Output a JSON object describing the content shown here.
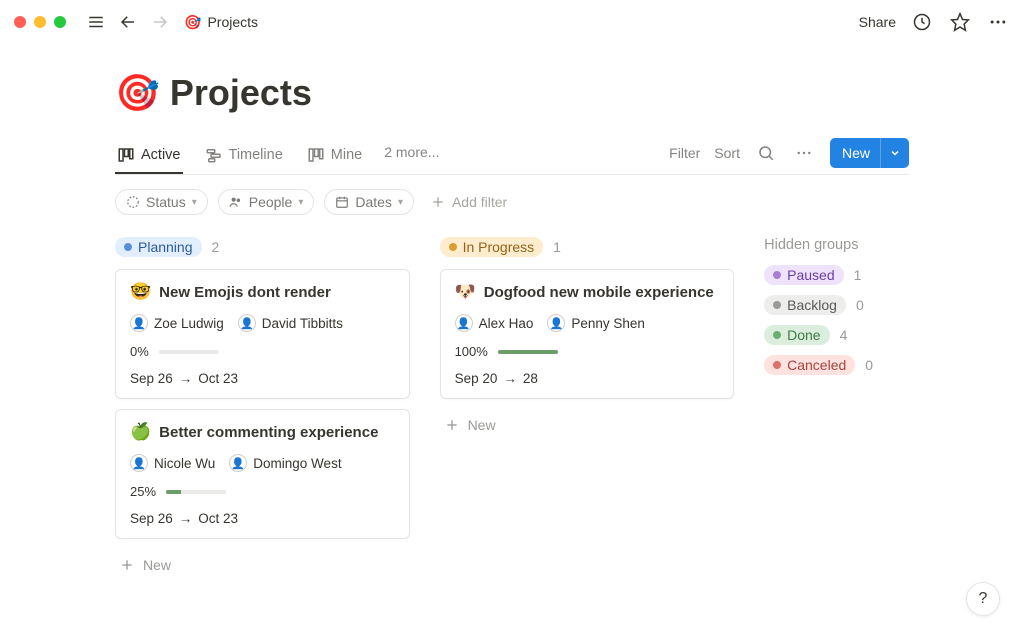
{
  "topbar": {
    "breadcrumb_icon": "🎯",
    "breadcrumb_title": "Projects",
    "share_label": "Share"
  },
  "page": {
    "icon": "🎯",
    "title": "Projects"
  },
  "tabs": {
    "items": [
      {
        "label": "Active"
      },
      {
        "label": "Timeline"
      },
      {
        "label": "Mine"
      }
    ],
    "more_label": "2 more...",
    "filter_label": "Filter",
    "sort_label": "Sort",
    "new_label": "New"
  },
  "filters": {
    "status_label": "Status",
    "people_label": "People",
    "dates_label": "Dates",
    "add_filter_label": "Add filter"
  },
  "board": {
    "columns": [
      {
        "tag_class": "planning",
        "label": "Planning",
        "count": "2",
        "cards": [
          {
            "emoji": "🤓",
            "title": "New Emojis dont  render",
            "people": [
              {
                "name": "Zoe Ludwig"
              },
              {
                "name": "David Tibbitts"
              }
            ],
            "progress_label": "0%",
            "progress_pct": 0,
            "date_from": "Sep 26",
            "date_to": "Oct 23"
          },
          {
            "emoji": "🍏",
            "title": "Better commenting experience",
            "people": [
              {
                "name": "Nicole Wu"
              },
              {
                "name": "Domingo West"
              }
            ],
            "progress_label": "25%",
            "progress_pct": 25,
            "date_from": "Sep 26",
            "date_to": "Oct 23"
          }
        ],
        "new_label": "New"
      },
      {
        "tag_class": "inprogress",
        "label": "In Progress",
        "count": "1",
        "cards": [
          {
            "emoji": "🐶",
            "title": "Dogfood new mobile experience",
            "people": [
              {
                "name": "Alex Hao"
              },
              {
                "name": "Penny Shen"
              }
            ],
            "progress_label": "100%",
            "progress_pct": 100,
            "date_from": "Sep 20",
            "date_to": "28"
          }
        ],
        "new_label": "New"
      }
    ],
    "hidden_title": "Hidden groups",
    "hidden_groups": [
      {
        "tag_class": "paused",
        "label": "Paused",
        "count": "1"
      },
      {
        "tag_class": "backlog",
        "label": "Backlog",
        "count": "0"
      },
      {
        "tag_class": "done",
        "label": "Done",
        "count": "4"
      },
      {
        "tag_class": "canceled",
        "label": "Canceled",
        "count": "0"
      }
    ]
  },
  "help_label": "?"
}
